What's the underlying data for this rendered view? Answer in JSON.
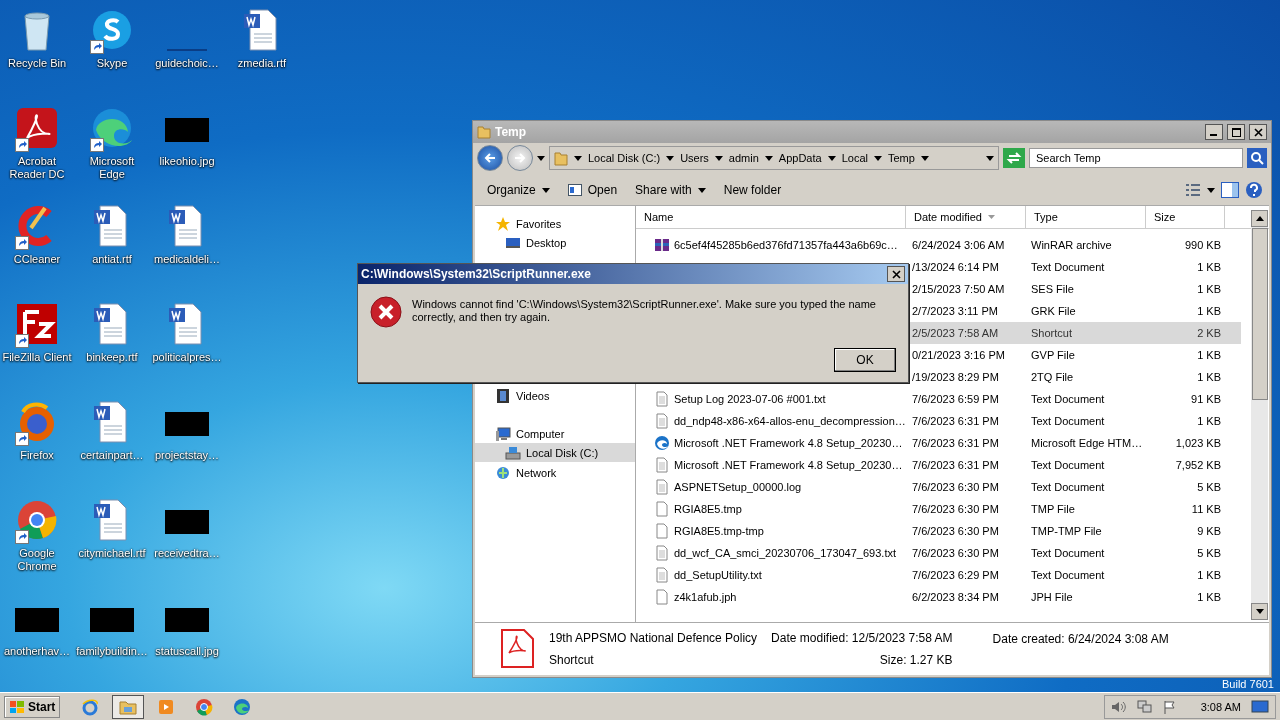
{
  "desktop": {
    "icon_rows": [
      [
        {
          "label": "Recycle Bin",
          "kind": "recycle",
          "shortcut": false
        },
        {
          "label": "Skype",
          "kind": "skype",
          "shortcut": true
        },
        {
          "label": "guidechoic…",
          "kind": "blank",
          "shortcut": false
        },
        {
          "label": "zmedia.rtf",
          "kind": "word",
          "shortcut": false
        }
      ],
      [
        {
          "label": "Acrobat Reader DC",
          "kind": "acrobat",
          "shortcut": true
        },
        {
          "label": "Microsoft Edge",
          "kind": "edge",
          "shortcut": true
        },
        {
          "label": "likeohio.jpg",
          "kind": "thumb",
          "shortcut": false
        }
      ],
      [
        {
          "label": "CCleaner",
          "kind": "ccleaner",
          "shortcut": true
        },
        {
          "label": "antiat.rtf",
          "kind": "word",
          "shortcut": false
        },
        {
          "label": "medicaldeli…",
          "kind": "word",
          "shortcut": false
        }
      ],
      [
        {
          "label": "FileZilla Client",
          "kind": "filezilla",
          "shortcut": true
        },
        {
          "label": "binkeep.rtf",
          "kind": "word",
          "shortcut": false
        },
        {
          "label": "politicalpres…",
          "kind": "word",
          "shortcut": false
        }
      ],
      [
        {
          "label": "Firefox",
          "kind": "firefox",
          "shortcut": true
        },
        {
          "label": "certainpart…",
          "kind": "word",
          "shortcut": false
        },
        {
          "label": "projectstay…",
          "kind": "thumb",
          "shortcut": false
        }
      ],
      [
        {
          "label": "Google Chrome",
          "kind": "chrome",
          "shortcut": true
        },
        {
          "label": "citymichael.rtf",
          "kind": "word",
          "shortcut": false
        },
        {
          "label": "receivedtra…",
          "kind": "thumb",
          "shortcut": false
        }
      ],
      [
        {
          "label": "anotherhav…",
          "kind": "thumb",
          "shortcut": false
        },
        {
          "label": "familybuildin…",
          "kind": "thumb",
          "shortcut": false
        },
        {
          "label": "statuscall.jpg",
          "kind": "thumb",
          "shortcut": false
        }
      ]
    ],
    "build_label": "Build 7601"
  },
  "explorer": {
    "title": "Temp",
    "address": [
      "Local Disk (C:)",
      "Users",
      "admin",
      "AppData",
      "Local",
      "Temp"
    ],
    "search": {
      "placeholder": "Search Temp"
    },
    "toolbar": [
      {
        "label": "Organize",
        "kind": "menu"
      },
      {
        "label": "Open",
        "kind": "open"
      },
      {
        "label": "Share with",
        "kind": "menu"
      },
      {
        "label": "New folder",
        "kind": "plain"
      }
    ],
    "nav_groups": [
      {
        "items": [
          {
            "label": "Favorites",
            "kind": "star",
            "selected": false
          },
          {
            "label": "Desktop",
            "kind": "desktop",
            "selected": false
          }
        ]
      },
      {
        "items": [
          {
            "label": "Videos",
            "kind": "videos",
            "selected": false
          }
        ]
      },
      {
        "items": [
          {
            "label": "Computer",
            "kind": "computer",
            "selected": false
          },
          {
            "label": "Local Disk (C:)",
            "kind": "disk",
            "selected": true
          }
        ]
      },
      {
        "items": [
          {
            "label": "Network",
            "kind": "network",
            "selected": false
          }
        ]
      }
    ],
    "columns": [
      {
        "label": "Name",
        "sorted": false
      },
      {
        "label": "Date modified",
        "sorted": true
      },
      {
        "label": "Type",
        "sorted": false
      },
      {
        "label": "Size",
        "sorted": false
      }
    ],
    "rows": [
      {
        "name": "6c5ef4f45285b6ed376fd71357fa443a6b69c…",
        "kind": "archive",
        "date": "6/24/2024 3:06 AM",
        "type": "WinRAR archive",
        "size": "990 KB",
        "selected": false
      },
      {
        "date": "/13/2024 6:14 PM",
        "type": "Text Document",
        "size": "1 KB",
        "selected": false
      },
      {
        "date": "2/15/2023 7:50 AM",
        "type": "SES File",
        "size": "1 KB",
        "selected": false
      },
      {
        "date": "2/7/2023 3:11 PM",
        "type": "GRK File",
        "size": "1 KB",
        "selected": false
      },
      {
        "date": "2/5/2023 7:58 AM",
        "type": "Shortcut",
        "size": "2 KB",
        "selected": true
      },
      {
        "date": "0/21/2023 3:16 PM",
        "type": "GVP File",
        "size": "1 KB",
        "selected": false
      },
      {
        "date": "/19/2023 8:29 PM",
        "type": "2TQ File",
        "size": "1 KB",
        "selected": false
      },
      {
        "name": "Setup Log 2023-07-06 #001.txt",
        "kind": "text",
        "date": "7/6/2023 6:59 PM",
        "type": "Text Document",
        "size": "91 KB",
        "selected": false
      },
      {
        "name": "dd_ndp48-x86-x64-allos-enu_decompression…",
        "kind": "text",
        "date": "7/6/2023 6:31 PM",
        "type": "Text Document",
        "size": "1 KB",
        "selected": false
      },
      {
        "name": "Microsoft .NET Framework 4.8 Setup_20230…",
        "kind": "edge",
        "date": "7/6/2023 6:31 PM",
        "type": "Microsoft Edge HTM…",
        "size": "1,023 KB",
        "selected": false
      },
      {
        "name": "Microsoft .NET Framework 4.8 Setup_20230…",
        "kind": "text",
        "date": "7/6/2023 6:31 PM",
        "type": "Text Document",
        "size": "7,952 KB",
        "selected": false
      },
      {
        "name": "ASPNETSetup_00000.log",
        "kind": "text",
        "date": "7/6/2023 6:30 PM",
        "type": "Text Document",
        "size": "5 KB",
        "selected": false
      },
      {
        "name": "RGIA8E5.tmp",
        "kind": "file",
        "date": "7/6/2023 6:30 PM",
        "type": "TMP File",
        "size": "11 KB",
        "selected": false
      },
      {
        "name": "RGIA8E5.tmp-tmp",
        "kind": "file",
        "date": "7/6/2023 6:30 PM",
        "type": "TMP-TMP File",
        "size": "9 KB",
        "selected": false
      },
      {
        "name": "dd_wcf_CA_smci_20230706_173047_693.txt",
        "kind": "text",
        "date": "7/6/2023 6:30 PM",
        "type": "Text Document",
        "size": "5 KB",
        "selected": false
      },
      {
        "name": "dd_SetupUtility.txt",
        "kind": "text",
        "date": "7/6/2023 6:29 PM",
        "type": "Text Document",
        "size": "1 KB",
        "selected": false
      },
      {
        "name": "z4k1afub.jph",
        "kind": "file",
        "date": "6/2/2023 8:34 PM",
        "type": "JPH File",
        "size": "1 KB",
        "selected": false
      }
    ],
    "details": {
      "name": "19th APPSMO National Defence Policy",
      "type": "Shortcut",
      "modified": "Date modified: 12/5/2023 7:58 AM",
      "size": "Size: 1.27 KB",
      "created": "Date created: 6/24/2024 3:08 AM"
    }
  },
  "dialog": {
    "title": "C:\\Windows\\System32\\ScriptRunner.exe",
    "message": "Windows cannot find 'C:\\Windows\\System32\\ScriptRunner.exe'. Make sure you typed the name correctly, and then try again.",
    "button": "OK"
  },
  "taskbar": {
    "start": "Start",
    "apps": [
      {
        "kind": "ie",
        "active": false
      },
      {
        "kind": "explorer",
        "active": true
      },
      {
        "kind": "media",
        "active": false
      },
      {
        "kind": "chrome",
        "active": false
      },
      {
        "kind": "edge",
        "active": false
      }
    ],
    "time": "3:08 AM"
  }
}
